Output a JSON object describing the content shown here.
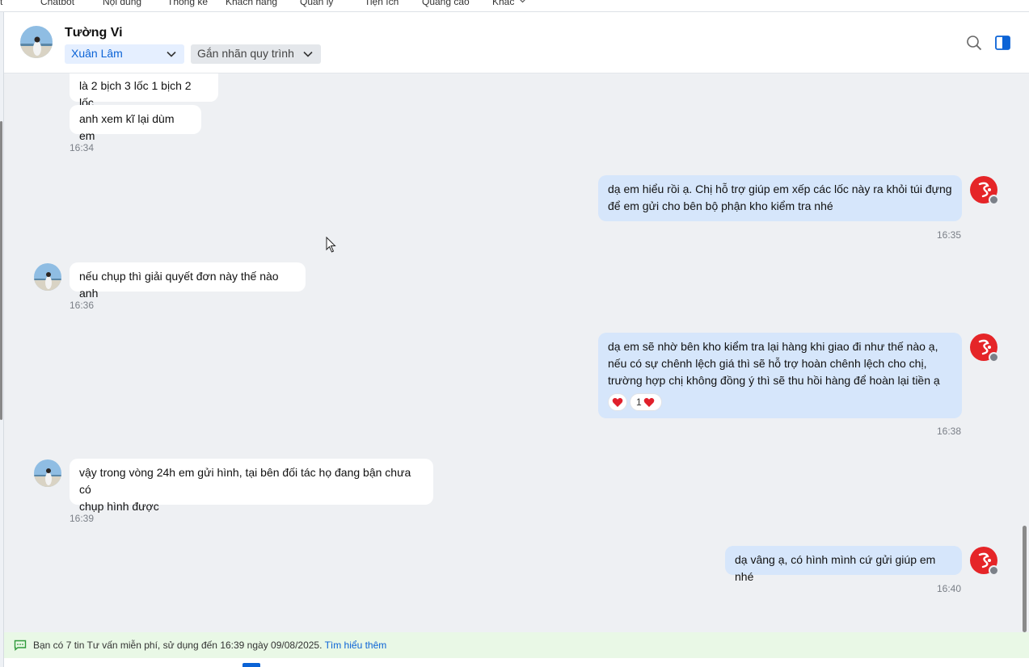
{
  "topnav": {
    "items": [
      "t",
      "Chatbot",
      "Nội dung",
      "Thống kê",
      "Khách hàng",
      "Quản lý",
      "Tiện ích",
      "Quảng cáo",
      "Khác"
    ]
  },
  "header": {
    "contact_name": "Tường Vi",
    "assignee": "Xuân Lâm",
    "tag_placeholder": "Gắn nhãn quy trình",
    "icons": [
      "search-icon",
      "side-panel-icon"
    ]
  },
  "messages": [
    {
      "direction": "in",
      "text": "là 2 bịch 3 lốc 1 bịch 2 lốc"
    },
    {
      "direction": "in",
      "text": "anh xem kĩ lại dùm em",
      "time": "16:34"
    },
    {
      "direction": "out",
      "lines": [
        "dạ em hiểu rồi ạ. Chị hỗ trợ giúp em xếp các lốc này ra khỏi túi đựng",
        "để em gửi cho bên bộ phận kho kiểm tra nhé"
      ],
      "time": "16:35"
    },
    {
      "direction": "in",
      "text": "nếu chụp thì giải quyết đơn này thế nào anh",
      "time": "16:36"
    },
    {
      "direction": "out",
      "lines": [
        "dạ em sẽ nhờ bên kho kiểm tra lại hàng khi giao đi như thế nào ạ,",
        "nếu có sự chênh lệch giá thì sẽ hỗ trợ hoàn chênh lệch cho chị,",
        "trường hợp chị không đồng ý thì sẽ thu hồi hàng để hoàn lại tiền ạ"
      ],
      "time": "16:38",
      "reaction_count": "1"
    },
    {
      "direction": "in",
      "lines": [
        "vậy trong vòng 24h em gửi hình, tại bên đối tác họ đang bận chưa có",
        "chụp hình được"
      ],
      "time": "16:39"
    },
    {
      "direction": "out",
      "text": "dạ vâng ạ, có hình mình cứ gửi giúp em nhé",
      "time": "16:40"
    }
  ],
  "notice": {
    "text": "Bạn có 7 tin Tư vấn miễn phí, sử dụng đến 16:39 ngày 09/08/2025.",
    "link": "Tìm hiểu thêm"
  },
  "colors": {
    "accent": "#0b63d6",
    "outgoing_bubble": "#d6e6fb",
    "chat_background": "#eef0f3",
    "shop_avatar": "#e52528",
    "notice_background": "#e9f8e6",
    "heart": "#e0202b"
  }
}
